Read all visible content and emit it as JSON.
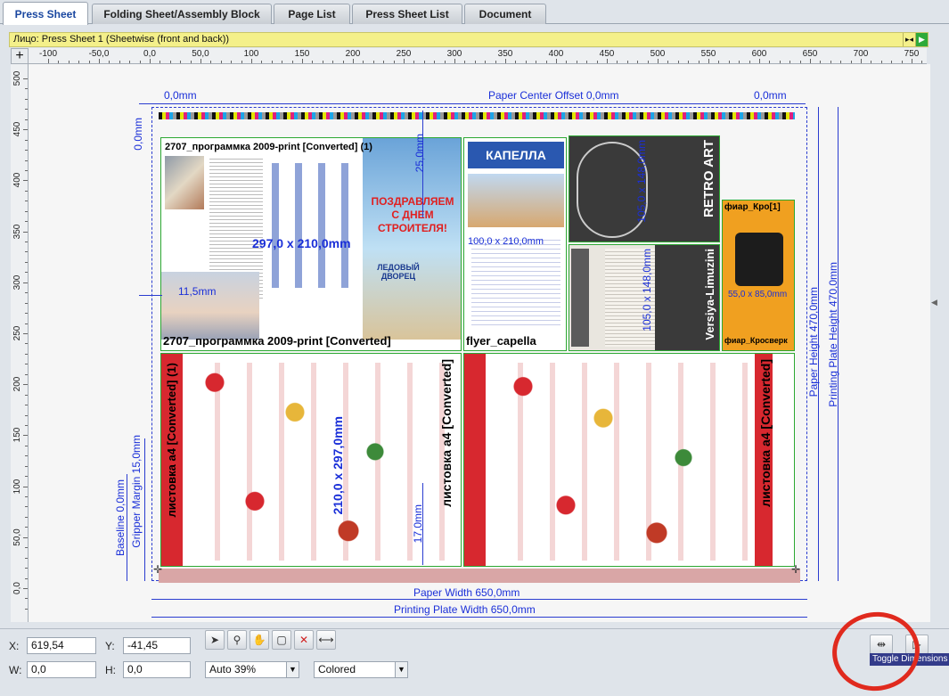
{
  "tabs": [
    {
      "label": "Press Sheet",
      "active": true
    },
    {
      "label": "Folding Sheet/Assembly Block",
      "active": false
    },
    {
      "label": "Page List",
      "active": false
    },
    {
      "label": "Press Sheet List",
      "active": false
    },
    {
      "label": "Document",
      "active": false
    }
  ],
  "sheet_bar": {
    "title": "Лицо:  Press Sheet 1 (Sheetwise (front and back))",
    "color": "#f4f08a"
  },
  "ruler": {
    "h_labels": [
      "-100",
      "-50,0",
      "0,0",
      "50,0",
      "100",
      "150",
      "200",
      "250",
      "300",
      "350",
      "400",
      "450",
      "500",
      "550",
      "600",
      "650",
      "700",
      "750"
    ],
    "v_labels": [
      "500",
      "450",
      "400",
      "350",
      "300",
      "250",
      "200",
      "150",
      "100",
      "50,0",
      "0,0"
    ]
  },
  "dimensions": {
    "left_offset": "0,0mm",
    "paper_center_offset": "Paper Center Offset 0,0mm",
    "right_offset": "0,0mm",
    "top_margin": "0,0mm",
    "gap_top": "25,0mm",
    "left_margin": "11,5mm",
    "gap_bottom": "17,0mm",
    "baseline": "Baseline 0,0mm",
    "gripper_margin": "Gripper Margin 15,0mm",
    "paper_width": "Paper Width 650,0mm",
    "plate_width": "Printing Plate Width 650,0mm",
    "paper_height": "Paper Height 470,0mm",
    "plate_height": "Printing Plate Height 470,0mm"
  },
  "documents": {
    "doc1_name": "2707_программка 2009-print [Converted] (1)",
    "doc1_size": "297,0 x 210,0mm",
    "doc1_label": "2707_программка 2009-print [Converted]",
    "doc1_headline": "ПОЗДРАВЛЯЕМ С ДНЕМ СТРОИТЕЛЯ!",
    "doc1_sub": "ЛЕДОВЫЙ ДВОРЕЦ",
    "doc2_name": "flyer_capella",
    "doc2_size": "100,0 x 210,0mm",
    "doc2_logo": "КАПЕЛЛА",
    "doc3_size": "105,0 x 148,0mm",
    "doc3_name": "RETRO ART",
    "doc4_size": "105,0 x 148,0mm",
    "doc4_name": "Versiya-Limuzini",
    "doc5_name": "фиар_Кросверк",
    "doc5_top": "фиар_Кро[1]",
    "doc5_size": "55,0 x 85,0mm",
    "doc6_name": "листовка а4 [Converted] (1)",
    "doc6_size": "210,0 x 297,0mm",
    "doc7_name": "листовка а4 [Converted]",
    "doc7_left": "листовка а4 [Converted]"
  },
  "status": {
    "x_label": "X:",
    "x_value": "619,54",
    "y_label": "Y:",
    "y_value": "-41,45",
    "w_label": "W:",
    "w_value": "0,0",
    "h_label": "H:",
    "h_value": "0,0",
    "zoom": "Auto 39%",
    "color_mode": "Colored",
    "tooltip": "Toggle Dimensions"
  },
  "colors": {
    "dimension_blue": "#1a2fd8",
    "frame_green": "#2ca832",
    "highlight_red": "#e02a1e"
  }
}
